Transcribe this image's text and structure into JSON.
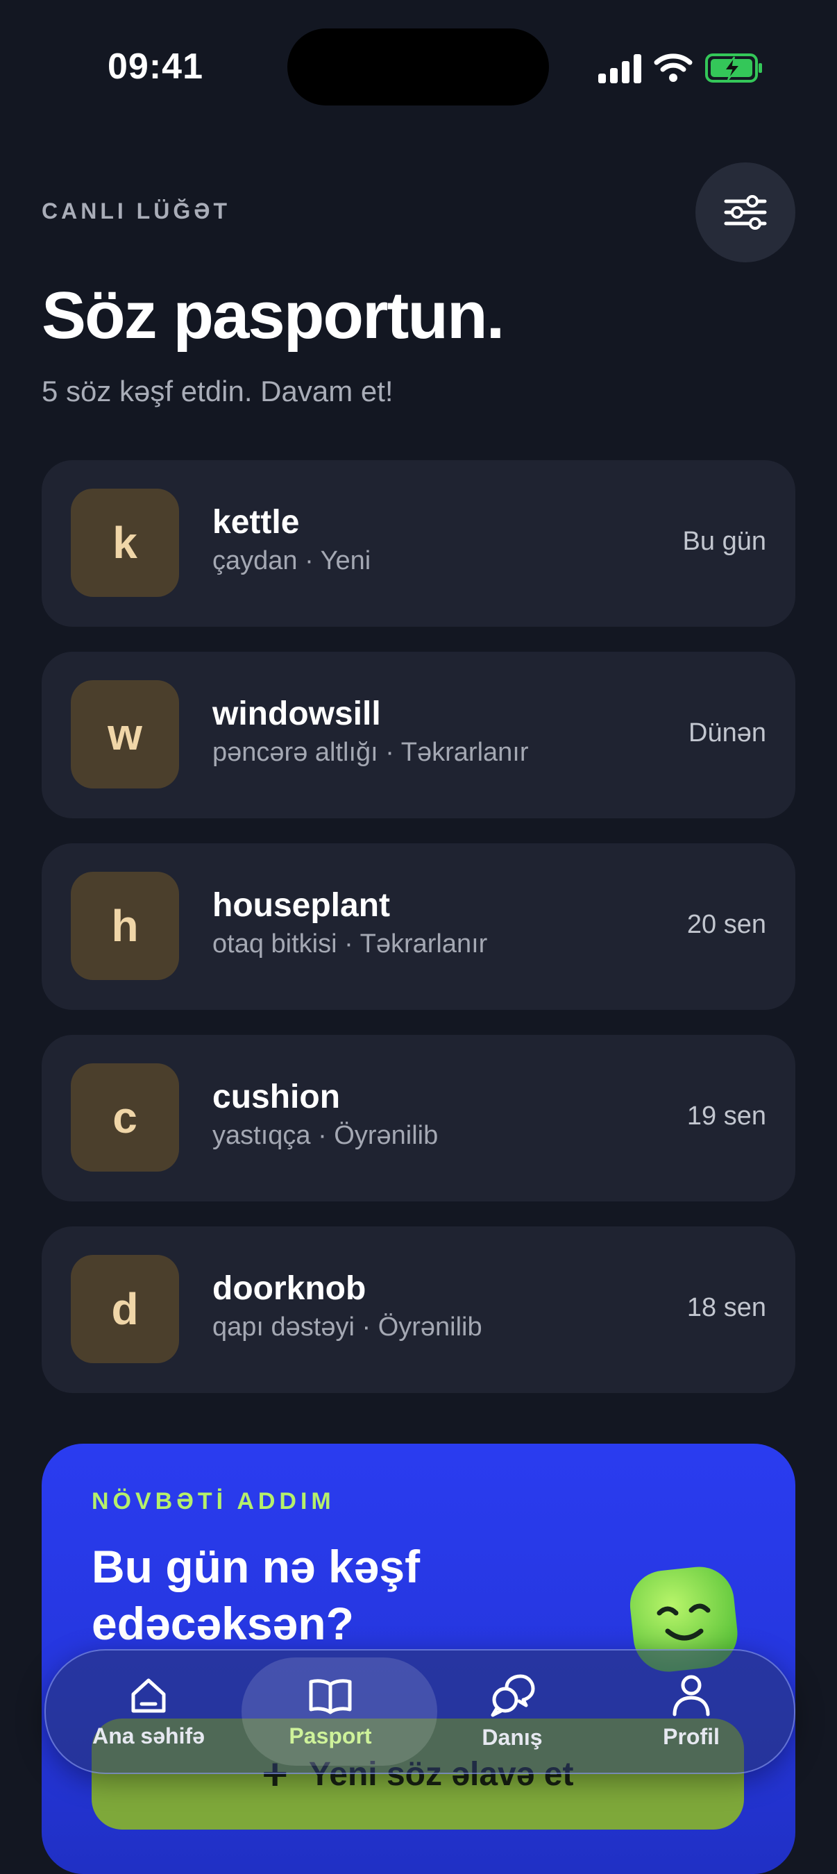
{
  "status_bar": {
    "time": "09:41"
  },
  "header": {
    "eyebrow": "CANLI LÜĞƏT",
    "title": "Söz pasportun.",
    "subtitle": "5 söz kəşf etdin. Davam et!"
  },
  "words": [
    {
      "letter": "k",
      "word": "kettle",
      "meta": "çaydan · Yeni",
      "when": "Bu gün"
    },
    {
      "letter": "w",
      "word": "windowsill",
      "meta": "pəncərə altlığı · Təkrarlanır",
      "when": "Dünən"
    },
    {
      "letter": "h",
      "word": "houseplant",
      "meta": "otaq bitkisi · Təkrarlanır",
      "when": "20 sen"
    },
    {
      "letter": "c",
      "word": "cushion",
      "meta": "yastıqça · Öyrənilib",
      "when": "19 sen"
    },
    {
      "letter": "d",
      "word": "doorknob",
      "meta": "qapı dəstəyi · Öyrənilib",
      "when": "18 sen"
    }
  ],
  "promo": {
    "eyebrow": "NÖVBƏTİ ADDIM",
    "title": "Bu gün nə kəşf edəcəksən?",
    "cta": "Yeni söz əlavə et"
  },
  "tabbar": [
    {
      "label": "Ana səhifə",
      "icon": "home-icon"
    },
    {
      "label": "Pasport",
      "icon": "book-icon",
      "active": true
    },
    {
      "label": "Danış",
      "icon": "chat-icon"
    },
    {
      "label": "Profil",
      "icon": "user-icon"
    }
  ],
  "colors": {
    "background": "#131722",
    "card": "#1f2331",
    "accent": "#b6f06a",
    "promo": "#2a3cf0"
  }
}
